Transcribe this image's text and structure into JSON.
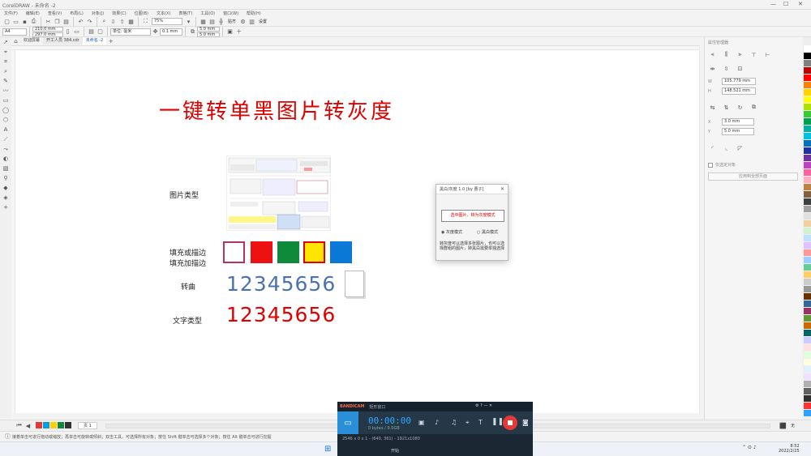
{
  "app": {
    "title": "CorelDRAW - 未命名 -2"
  },
  "menu": [
    "文件(F)",
    "编辑(E)",
    "查看(V)",
    "布局(L)",
    "对象(J)",
    "效果(C)",
    "位图(B)",
    "文本(X)",
    "表格(T)",
    "工具(O)",
    "窗口(W)",
    "帮助(H)"
  ],
  "toolbar1": {
    "zoom": "75%",
    "snap": "贴齐",
    "settings": "设置"
  },
  "toolbar2": {
    "paper": "A4",
    "width": "210.0 mm",
    "height": "297.0 mm",
    "units": "单位: 毫米",
    "nudge": "0.1 mm",
    "dup_x": "5.0 mm",
    "dup_y": "5.0 mm"
  },
  "tabs": [
    "欢迎屏幕",
    "开工人员 384.cdr",
    "未命名 -2"
  ],
  "content": {
    "heading": "一键转单黑图片转灰度",
    "label_image": "图片类型",
    "label_fill1": "填充或描边",
    "label_fill2": "填充加描边",
    "label_curve": "转曲",
    "label_text": "文字类型",
    "number_blue": "12345656",
    "number_red": "12345656"
  },
  "colors": {
    "heading": "#e00000",
    "blue_number": "#4a72b0",
    "red_number": "#e00000",
    "swatch_red": "#ee1111",
    "swatch_green": "#0f8a3a",
    "swatch_yellow": "#ffe600",
    "swatch_blue": "#0a78d6",
    "swatch_outline": "#b5306a"
  },
  "dialog": {
    "title": "黑白/灰度 1.0 [by 曹子]",
    "button": "选中图片、转为灰度模式",
    "radio1": "灰度模式",
    "radio2": "黑白模式",
    "note": "转灰度可以选择多张图片，也可以选择群组的图片，转黑白需要单独选择"
  },
  "docker": {
    "title": "属性管理器",
    "w": "105.779 mm",
    "h": "148.521 mm",
    "outline1": "3.0 mm",
    "outline2": "5.0 mm",
    "checkbox": "仅选定对象",
    "button": "应用到全部页面"
  },
  "statusbar": {
    "hint": "接着单击可进行拖动或缩放；再单击可旋转或倾斜；双击工具，可选择所有对象；按住 Shift 键单击可选择多个对象；按住 Alt 键单击可进行挖掘",
    "page": "页 1",
    "fill": "无"
  },
  "bandicam": {
    "brand": "BANDICAM",
    "mode": "矩形窗口",
    "timer": "00:00:00",
    "size": "0 bytes / 9.5GB",
    "resolution": "2546 x 0 x 1 - (640, 361) - 1921x1080",
    "bottom": "开始"
  },
  "taskbar": {
    "time": "8:52",
    "date": "2022/2/25"
  }
}
